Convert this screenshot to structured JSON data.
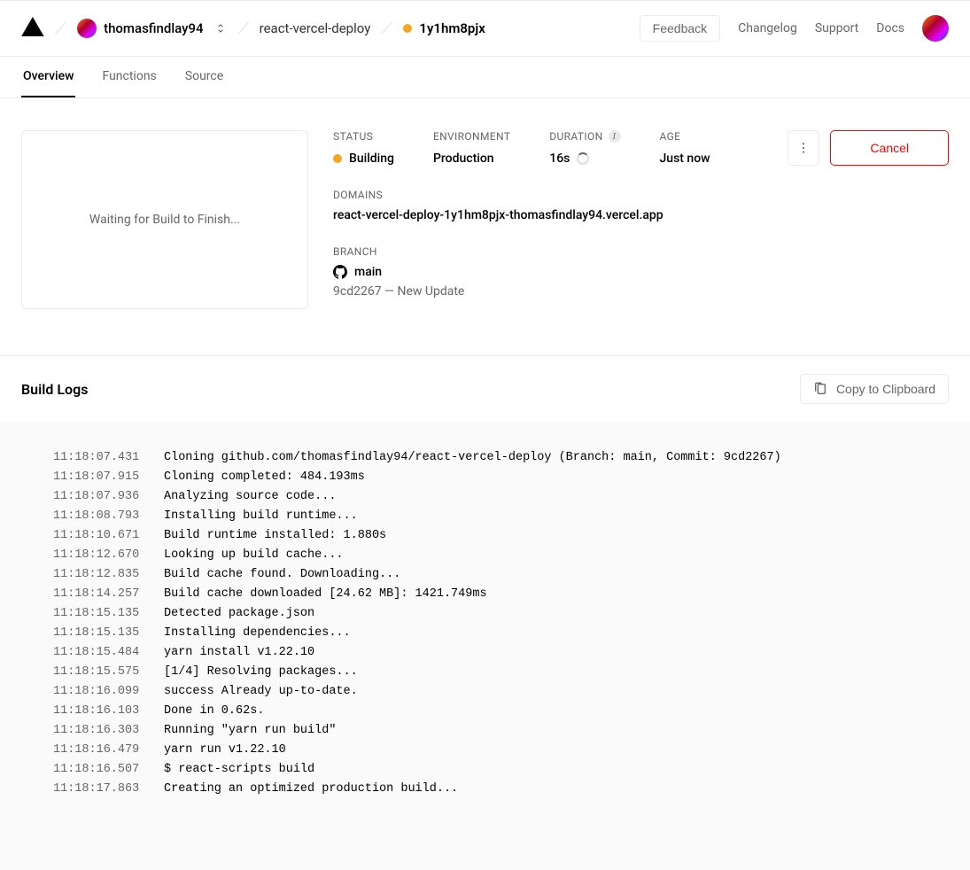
{
  "header": {
    "scope_owner": "thomasfindlay94",
    "project": "react-vercel-deploy",
    "deployment_id": "1y1hm8pjx",
    "feedback_label": "Feedback",
    "links": [
      "Changelog",
      "Support",
      "Docs"
    ]
  },
  "tabs": [
    {
      "label": "Overview",
      "active": true
    },
    {
      "label": "Functions",
      "active": false
    },
    {
      "label": "Source",
      "active": false
    }
  ],
  "preview_placeholder": "Waiting for Build to Finish...",
  "meta": {
    "status_label": "STATUS",
    "status_value": "Building",
    "env_label": "ENVIRONMENT",
    "env_value": "Production",
    "duration_label": "DURATION",
    "duration_value": "16s",
    "age_label": "AGE",
    "age_value": "Just now"
  },
  "actions": {
    "cancel_label": "Cancel"
  },
  "domains": {
    "label": "DOMAINS",
    "value": "react-vercel-deploy-1y1hm8pjx-thomasfindlay94.vercel.app"
  },
  "branch": {
    "label": "BRANCH",
    "name": "main",
    "commit_hash": "9cd2267",
    "commit_separator": " — ",
    "commit_message": "New Update"
  },
  "logs_header": {
    "title": "Build Logs",
    "copy_label": "Copy to Clipboard"
  },
  "logs": [
    {
      "ts": "11:18:07.431",
      "msg": "Cloning github.com/thomasfindlay94/react-vercel-deploy (Branch: main, Commit: 9cd2267)"
    },
    {
      "ts": "11:18:07.915",
      "msg": "Cloning completed: 484.193ms"
    },
    {
      "ts": "11:18:07.936",
      "msg": "Analyzing source code..."
    },
    {
      "ts": "11:18:08.793",
      "msg": "Installing build runtime..."
    },
    {
      "ts": "11:18:10.671",
      "msg": "Build runtime installed: 1.880s"
    },
    {
      "ts": "11:18:12.670",
      "msg": "Looking up build cache..."
    },
    {
      "ts": "11:18:12.835",
      "msg": "Build cache found. Downloading..."
    },
    {
      "ts": "11:18:14.257",
      "msg": "Build cache downloaded [24.62 MB]: 1421.749ms"
    },
    {
      "ts": "11:18:15.135",
      "msg": "Detected package.json"
    },
    {
      "ts": "11:18:15.135",
      "msg": "Installing dependencies..."
    },
    {
      "ts": "11:18:15.484",
      "msg": "yarn install v1.22.10"
    },
    {
      "ts": "11:18:15.575",
      "msg": "[1/4] Resolving packages..."
    },
    {
      "ts": "11:18:16.099",
      "msg": "success Already up-to-date."
    },
    {
      "ts": "11:18:16.103",
      "msg": "Done in 0.62s."
    },
    {
      "ts": "11:18:16.303",
      "msg": "Running \"yarn run build\""
    },
    {
      "ts": "11:18:16.479",
      "msg": "yarn run v1.22.10"
    },
    {
      "ts": "11:18:16.507",
      "msg": "$ react-scripts build"
    },
    {
      "ts": "11:18:17.863",
      "msg": "Creating an optimized production build..."
    }
  ]
}
